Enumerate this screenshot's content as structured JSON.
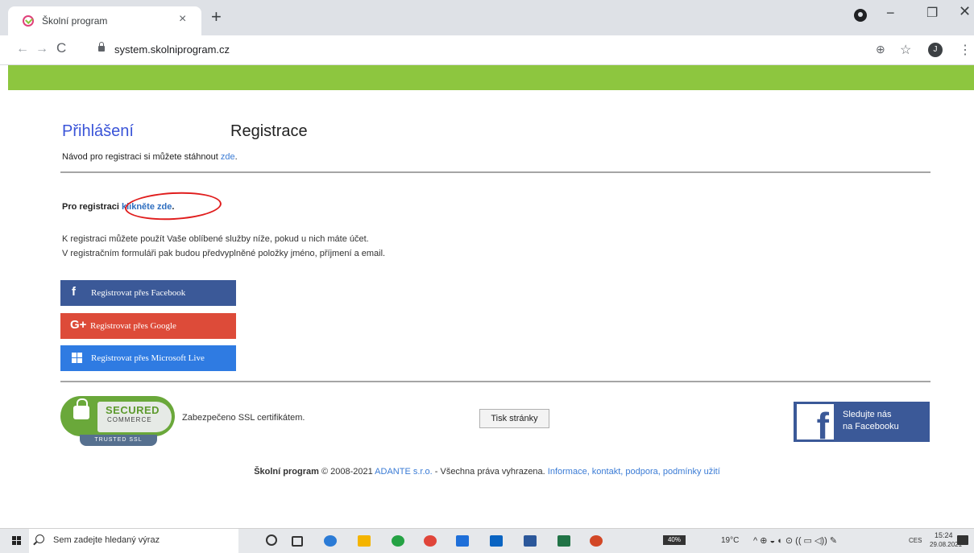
{
  "browser": {
    "tab_title": "Školní program",
    "tab_close": "×",
    "new_tab": "+",
    "window": {
      "minimize": "−",
      "maximize": "❐",
      "close": "✕"
    },
    "url": "system.skolniprogram.cz",
    "nav": {
      "back": "←",
      "forward": "→",
      "reload": "C"
    },
    "profile_initial": "J",
    "icons": {
      "zoom": "⊕",
      "star": "☆",
      "menu": "⋮"
    }
  },
  "page": {
    "header_color": "#8dc63f",
    "tabs": {
      "login": "Přihlášení",
      "register": "Registrace"
    },
    "guide": {
      "text": "Návod pro registraci si můžete stáhnout ",
      "link": "zde",
      "suffix": "."
    },
    "register_prompt": {
      "text": "Pro registraci ",
      "link": "klikněte zde",
      "suffix": "."
    },
    "info_line1": "K registraci můžete použít Vaše oblíbené služby níže, pokud u nich máte účet.",
    "info_line2": "V registračním formuláři pak budou předvyplněné položky jméno, příjmení a email.",
    "social_buttons": [
      {
        "label": "Registrovat přes Facebook",
        "icon": "f",
        "color": "#3b5998"
      },
      {
        "label": "Registrovat přes Google",
        "icon": "G+",
        "color": "#dd4b39"
      },
      {
        "label": "Registrovat přes Microsoft Live",
        "icon": "windows-icon",
        "color": "#2f7be2"
      }
    ],
    "ssl_badge": {
      "secured": "SECURED",
      "commerce": "COMMERCE",
      "trusted": "TRUSTED SSL"
    },
    "ssl_text": "Zabezpečeno SSL certifikátem.",
    "print_button": "Tisk stránky",
    "facebook_follow": {
      "icon": "f",
      "line1": "Sledujte nás",
      "line2": "na Facebooku"
    },
    "footer": {
      "brand": "Školní program",
      "copyright": " © 2008-2021 ",
      "company": "ADANTE s.r.o.",
      "rights": " - Všechna práva vyhrazena. ",
      "links": "Informace, kontakt, podpora, podmínky užití"
    }
  },
  "taskbar": {
    "search_placeholder": "Sem zadejte hledaný výraz",
    "battery": "40%",
    "weather": "19°C",
    "tray_symbols": "^  ⊕  ◒  ◐  ⊙  ((  ▭  ◁))  ✎",
    "language": "CES",
    "time": "15:24",
    "date": "29.08.2021"
  }
}
